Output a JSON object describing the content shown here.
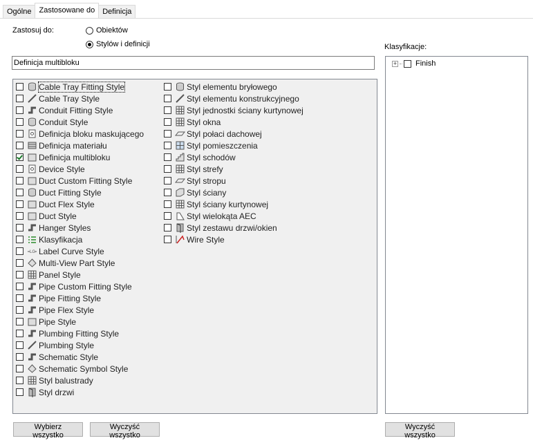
{
  "tabs": [
    {
      "label": "Ogólne",
      "active": false
    },
    {
      "label": "Zastosowane do",
      "active": true
    },
    {
      "label": "Definicja",
      "active": false
    }
  ],
  "apply_to": {
    "label": "Zastosuj do:",
    "options": [
      {
        "label": "Obiektów",
        "selected": false
      },
      {
        "label": "Stylów i definicji",
        "selected": true
      }
    ]
  },
  "filter_value": "Definicja multibloku",
  "classifications_label": "Klasyfikacje:",
  "tree": {
    "expander": "+",
    "label": "Finish",
    "checked": false
  },
  "list": {
    "col1": [
      {
        "label": "Cable Tray Fitting Style",
        "icon": "cable-tray-fitting-icon",
        "checked": false
      },
      {
        "label": "Cable Tray Style",
        "icon": "cable-tray-icon",
        "checked": false
      },
      {
        "label": "Conduit Fitting Style",
        "icon": "conduit-fitting-icon",
        "checked": false
      },
      {
        "label": "Conduit Style",
        "icon": "conduit-icon",
        "checked": false
      },
      {
        "label": "Definicja bloku maskującego",
        "icon": "mask-block-icon",
        "checked": false
      },
      {
        "label": "Definicja materiału",
        "icon": "material-icon",
        "checked": false
      },
      {
        "label": "Definicja multibloku",
        "icon": "multiblock-icon",
        "checked": true
      },
      {
        "label": "Device Style",
        "icon": "device-icon",
        "checked": false
      },
      {
        "label": "Duct Custom Fitting Style",
        "icon": "duct-custom-fitting-icon",
        "checked": false
      },
      {
        "label": "Duct Fitting Style",
        "icon": "duct-fitting-icon",
        "checked": false
      },
      {
        "label": "Duct Flex Style",
        "icon": "duct-flex-icon",
        "checked": false
      },
      {
        "label": "Duct Style",
        "icon": "duct-icon",
        "checked": false
      },
      {
        "label": "Hanger Styles",
        "icon": "hanger-icon",
        "checked": false
      },
      {
        "label": "Klasyfikacja",
        "icon": "classification-icon",
        "checked": false
      },
      {
        "label": "Label Curve Style",
        "icon": "label-curve-icon",
        "checked": false
      },
      {
        "label": "Multi-View Part Style",
        "icon": "multi-view-part-icon",
        "checked": false
      },
      {
        "label": "Panel Style",
        "icon": "panel-icon",
        "checked": false
      },
      {
        "label": "Pipe Custom Fitting Style",
        "icon": "pipe-custom-fitting-icon",
        "checked": false
      },
      {
        "label": "Pipe Fitting Style",
        "icon": "pipe-fitting-icon",
        "checked": false
      },
      {
        "label": "Pipe Flex Style",
        "icon": "pipe-flex-icon",
        "checked": false
      },
      {
        "label": "Pipe Style",
        "icon": "pipe-icon",
        "checked": false
      },
      {
        "label": "Plumbing Fitting Style",
        "icon": "plumbing-fitting-icon",
        "checked": false
      },
      {
        "label": "Plumbing Style",
        "icon": "plumbing-icon",
        "checked": false
      },
      {
        "label": "Schematic Style",
        "icon": "schematic-icon",
        "checked": false
      },
      {
        "label": "Schematic Symbol Style",
        "icon": "schematic-symbol-icon",
        "checked": false
      },
      {
        "label": "Styl balustrady",
        "icon": "railing-icon",
        "checked": false
      },
      {
        "label": "Styl drzwi",
        "icon": "door-icon",
        "checked": false
      }
    ],
    "col2": [
      {
        "label": "Styl elementu bryłowego",
        "icon": "mass-element-icon",
        "checked": false
      },
      {
        "label": "Styl elementu konstrukcyjnego",
        "icon": "structural-member-icon",
        "checked": false
      },
      {
        "label": "Styl jednostki ściany kurtynowej",
        "icon": "curtain-wall-unit-icon",
        "checked": false
      },
      {
        "label": "Styl okna",
        "icon": "window-icon",
        "checked": false
      },
      {
        "label": "Styl połaci dachowej",
        "icon": "roof-slab-icon",
        "checked": false
      },
      {
        "label": "Styl pomieszczenia",
        "icon": "space-icon",
        "checked": false
      },
      {
        "label": "Styl schodów",
        "icon": "stair-icon",
        "checked": false
      },
      {
        "label": "Styl strefy",
        "icon": "zone-icon",
        "checked": false
      },
      {
        "label": "Styl stropu",
        "icon": "slab-icon",
        "checked": false
      },
      {
        "label": "Styl ściany",
        "icon": "wall-icon",
        "checked": false
      },
      {
        "label": "Styl ściany kurtynowej",
        "icon": "curtain-wall-icon",
        "checked": false
      },
      {
        "label": "Styl wielokąta AEC",
        "icon": "aec-polygon-icon",
        "checked": false
      },
      {
        "label": "Styl zestawu drzwi/okien",
        "icon": "door-window-assembly-icon",
        "checked": false
      },
      {
        "label": "Wire Style",
        "icon": "wire-icon",
        "checked": false
      }
    ]
  },
  "buttons": {
    "select_all": "Wybierz wszystko",
    "clear_all": "Wyczyść wszystko",
    "clear_all_right": "Wyczyść wszystko"
  }
}
